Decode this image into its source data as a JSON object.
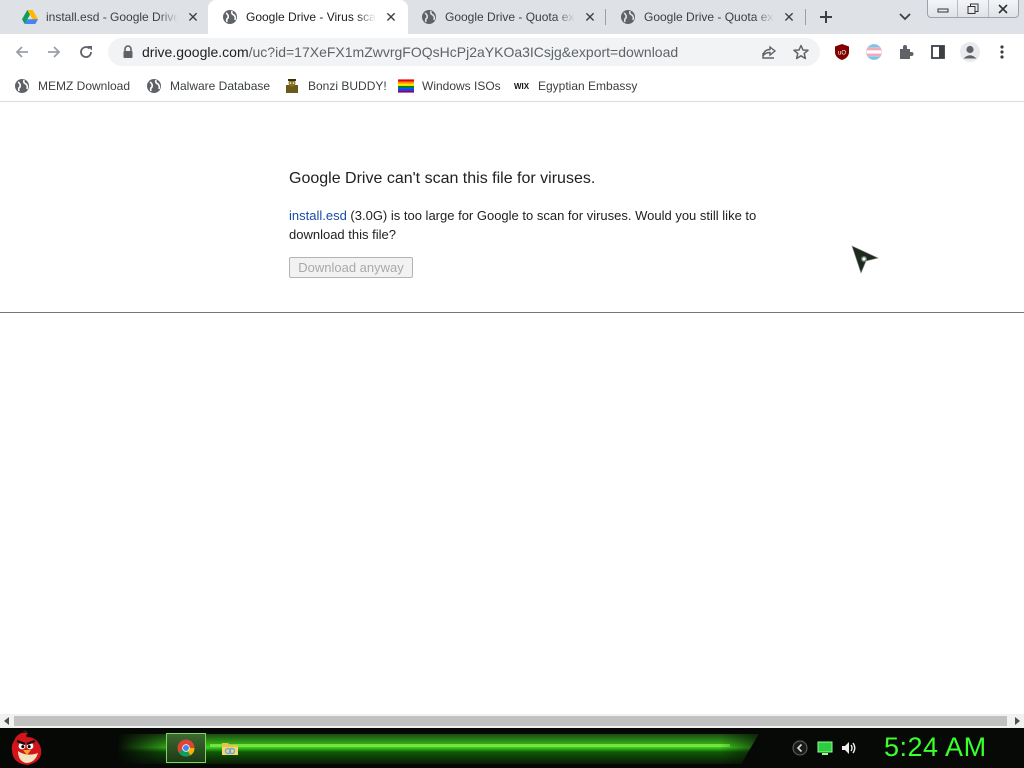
{
  "tabs": [
    {
      "title": "install.esd - Google Drive",
      "icon": "google-drive-icon",
      "active": false
    },
    {
      "title": "Google Drive - Virus scan warning",
      "icon": "globe-icon",
      "active": true
    },
    {
      "title": "Google Drive - Quota exceeded",
      "icon": "globe-icon",
      "active": false
    },
    {
      "title": "Google Drive - Quota exceeded",
      "icon": "globe-icon",
      "active": false
    }
  ],
  "toolbar": {
    "url_host": "drive.google.com",
    "url_path": "/uc?id=17XeFX1mZwvrgFOQsHcPj2aYKOa3ICsjg&export=download"
  },
  "bookmarks": [
    {
      "label": "MEMZ Download",
      "icon": "globe-icon"
    },
    {
      "label": "Malware Database",
      "icon": "globe-icon"
    },
    {
      "label": "Bonzi BUDDY!",
      "icon": "bonzi-icon"
    },
    {
      "label": "Windows ISOs",
      "icon": "rainbow-flag-icon"
    },
    {
      "label": "Egyptian Embassy",
      "icon": "wix-icon"
    }
  ],
  "page": {
    "heading": "Google Drive can't scan this file for viruses.",
    "file_link": "install.esd",
    "message_rest": " (3.0G) is too large for Google to scan for viruses. Would you still like to download this file?",
    "download_button": "Download anyway"
  },
  "taskbar": {
    "clock": "5:24 AM",
    "accent_color": "#3cff2e"
  }
}
